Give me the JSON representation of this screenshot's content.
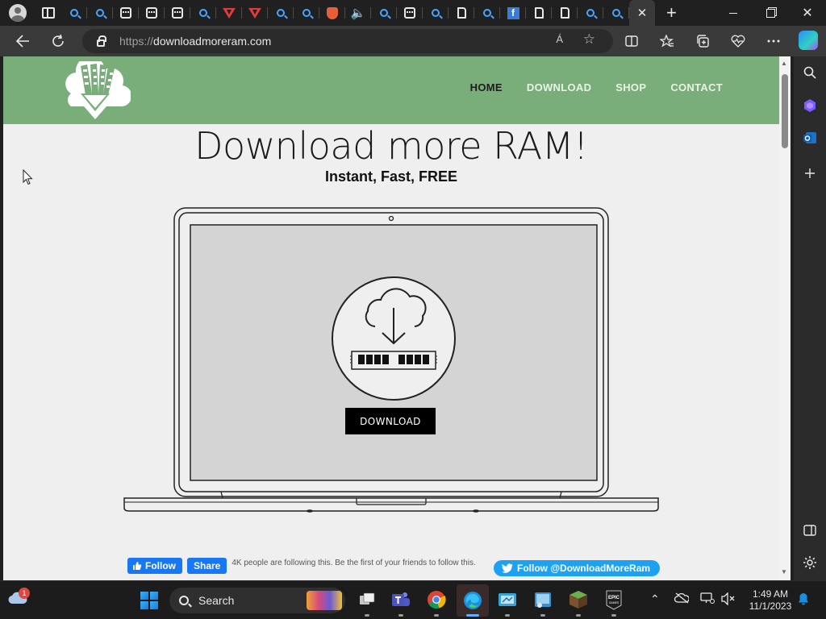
{
  "browser": {
    "tabs": [
      {
        "icon": "search-icon"
      },
      {
        "icon": "search-icon"
      },
      {
        "icon": "calendar-icon"
      },
      {
        "icon": "calendar-icon"
      },
      {
        "icon": "calendar-icon"
      },
      {
        "icon": "search-icon"
      },
      {
        "icon": "v-logo-icon"
      },
      {
        "icon": "v-logo-icon"
      },
      {
        "icon": "search-icon"
      },
      {
        "icon": "search-icon"
      },
      {
        "icon": "shield-icon"
      },
      {
        "icon": "speaker-icon"
      },
      {
        "icon": "search-icon"
      },
      {
        "icon": "calendar-icon"
      },
      {
        "icon": "search-icon"
      },
      {
        "icon": "document-icon"
      },
      {
        "icon": "search-icon"
      },
      {
        "icon": "f-logo-icon"
      },
      {
        "icon": "document-icon"
      },
      {
        "icon": "document-icon"
      },
      {
        "icon": "search-icon"
      },
      {
        "icon": "search-icon"
      }
    ],
    "new_tab_label": "+",
    "close_tab_label": "✕",
    "address": {
      "protocol": "https://",
      "host": "downloadmoreram.com"
    },
    "read_aloud_label": "Á",
    "favorite_label": "☆"
  },
  "site": {
    "nav": [
      {
        "label": "HOME",
        "current": true
      },
      {
        "label": "DOWNLOAD",
        "current": false
      },
      {
        "label": "SHOP",
        "current": false
      },
      {
        "label": "CONTACT",
        "current": false
      }
    ],
    "title": "Download more RAM!",
    "subtitle": "Instant, Fast, FREE",
    "download_button": "DOWNLOAD",
    "facebook": {
      "follow": "Follow",
      "share": "Share",
      "text": "4K people are following this. Be the first of your friends to follow this."
    },
    "twitter_follow": "Follow @DownloadMoreRam"
  },
  "taskbar": {
    "weather_badge": "1",
    "search_label": "Search",
    "time": "1:49 AM",
    "date": "11/1/2023"
  },
  "colors": {
    "header_green": "#79ad79",
    "page_bg": "#efefef",
    "facebook_blue": "#1877f2",
    "twitter_blue": "#1da1f2"
  }
}
